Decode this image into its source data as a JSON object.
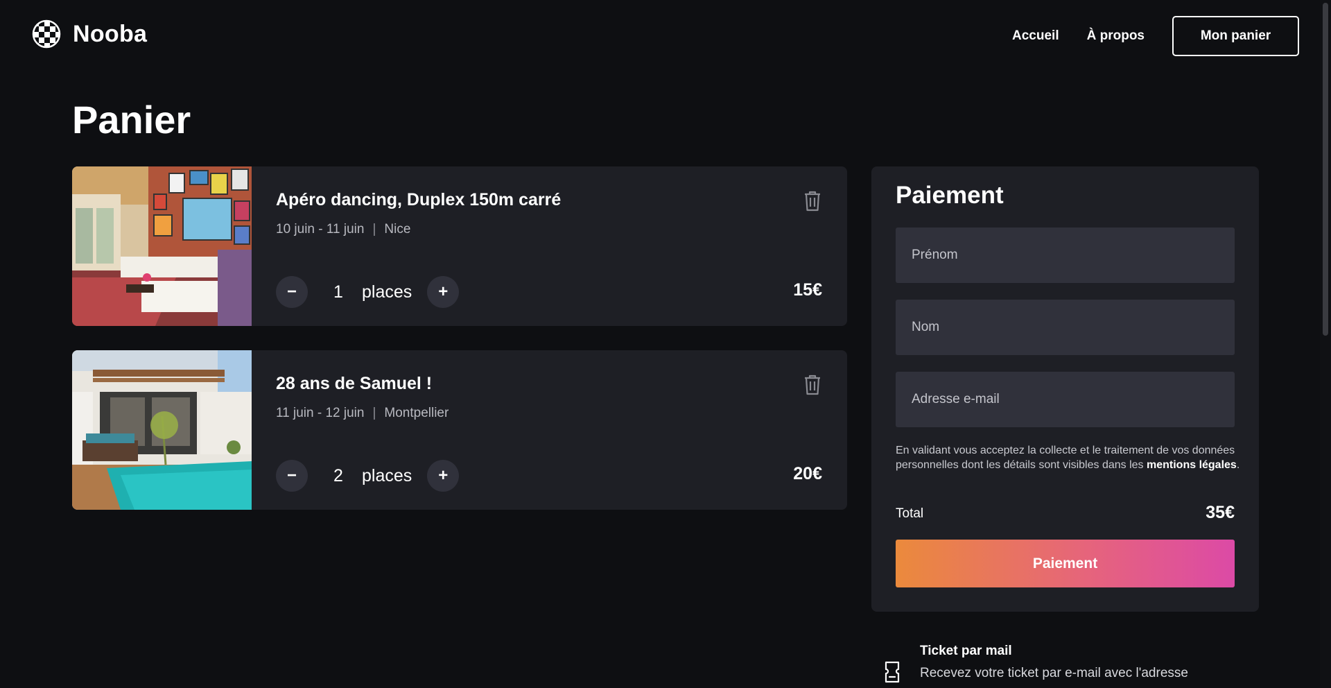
{
  "brand": {
    "name": "Nooba",
    "logo_icon": "checkered-globe-icon"
  },
  "nav": {
    "links": [
      "Accueil",
      "À propos"
    ],
    "cart_button": "Mon panier"
  },
  "page_title": "Panier",
  "cart_items": [
    {
      "title": "Apéro dancing, Duplex 150m carré",
      "dates": "10 juin - 11 juin",
      "city": "Nice",
      "quantity": "1",
      "unit": "places",
      "price": "15€",
      "image": "living-room-photo",
      "minus_label": "−",
      "plus_label": "+"
    },
    {
      "title": "28 ans de Samuel !",
      "dates": "11 juin - 12 juin",
      "city": "Montpellier",
      "quantity": "2",
      "unit": "places",
      "price": "20€",
      "image": "pool-house-photo",
      "minus_label": "−",
      "plus_label": "+"
    }
  ],
  "payment": {
    "title": "Paiement",
    "first_name_placeholder": "Prénom",
    "last_name_placeholder": "Nom",
    "email_placeholder": "Adresse e-mail",
    "consent_text": "En validant vous acceptez la collecte et le traitement de vos données personnelles dont les détails sont visibles dans les",
    "consent_link": "mentions légales",
    "consent_end": ".",
    "total_label": "Total",
    "total_value": "35€",
    "submit_label": "Paiement"
  },
  "ticket_info": {
    "title": "Ticket par mail",
    "description": "Recevez votre ticket par e-mail avec l'adresse"
  },
  "colors": {
    "background": "#0e0f12",
    "card": "#1e1f25",
    "field": "#30313b",
    "gradient_start": "#eb8a3c",
    "gradient_end": "#dc4aa6"
  }
}
